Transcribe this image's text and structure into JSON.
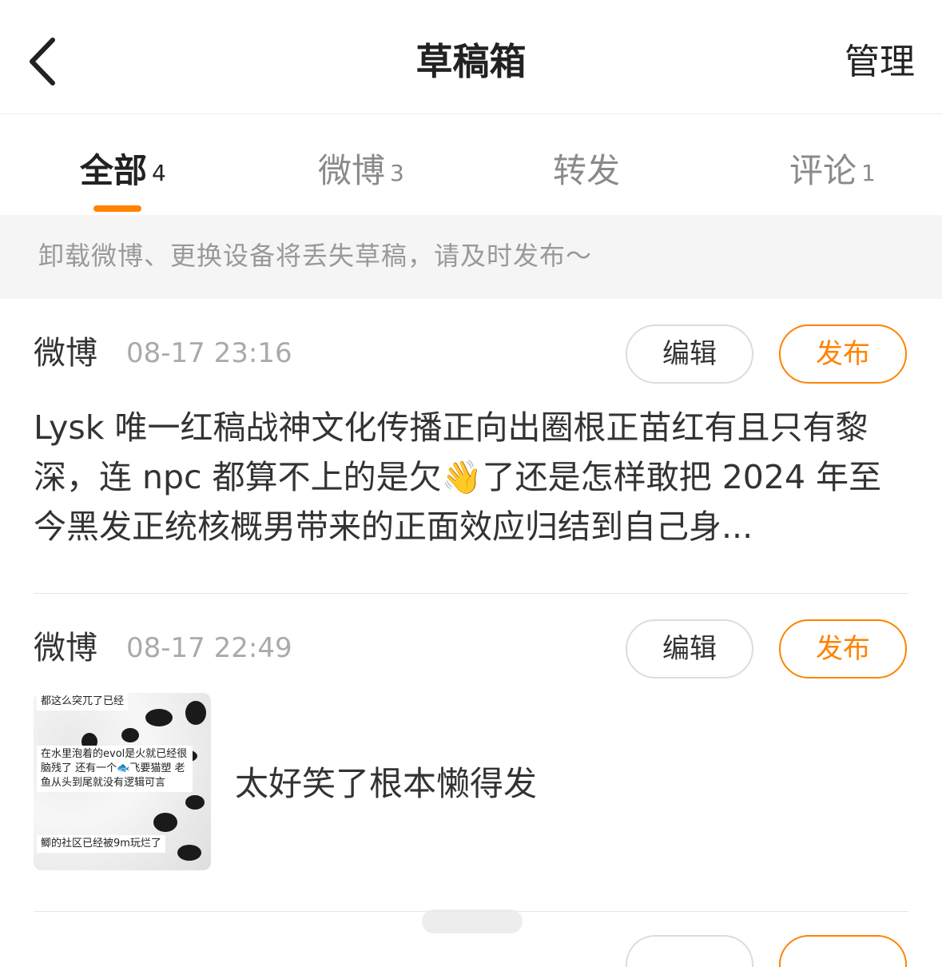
{
  "header": {
    "title": "草稿箱",
    "manage_label": "管理"
  },
  "tabs": [
    {
      "label": "全部",
      "count": "4"
    },
    {
      "label": "微博",
      "count": "3"
    },
    {
      "label": "转发",
      "count": ""
    },
    {
      "label": "评论",
      "count": "1"
    }
  ],
  "notice": "卸载微博、更换设备将丢失草稿，请及时发布～",
  "drafts": [
    {
      "type": "微博",
      "time": "08-17 23:16",
      "edit_label": "编辑",
      "publish_label": "发布",
      "content": "Lysk 唯一红稿战神文化传播正向出圈根正苗红有且只有黎深，连 npc 都算不上的是欠👋了还是怎样敢把 2024 年至今黑发正统核概男带来的正面效应归结到自己身..."
    },
    {
      "type": "微博",
      "time": "08-17 22:49",
      "edit_label": "编辑",
      "publish_label": "发布",
      "thumbnail_texts": [
        "都这么突兀了已经",
        "在水里泡着的evol是火就已经很脑残了 还有一个🐟飞要猫塑 老鱼从头到尾就没有逻辑可言",
        "鲫的社区已经被9m玩烂了"
      ],
      "caption": "太好笑了根本懒得发"
    }
  ]
}
